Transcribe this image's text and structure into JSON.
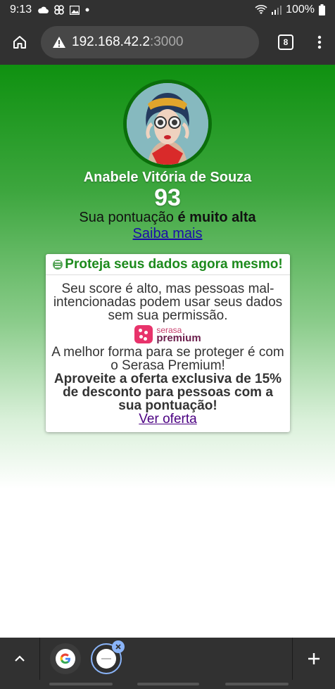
{
  "status_bar": {
    "time": "9:13",
    "battery": "100%",
    "icons": [
      "cloud-icon",
      "pinwheel-icon",
      "image-icon",
      "dot-icon",
      "wifi-icon",
      "signal-icon",
      "battery-icon"
    ]
  },
  "browser": {
    "url_host": "192.168.42.2",
    "url_port": ":3000",
    "tab_count": "8",
    "icons": [
      "home-icon",
      "warning-icon",
      "menu-icon"
    ]
  },
  "profile": {
    "name": "Anabele Vitória de Souza",
    "score": "93",
    "score_prefix": "Sua pontuação ",
    "score_level": "é muito alta",
    "learn_more": "Saiba mais"
  },
  "card": {
    "title": "Proteja seus dados agora mesmo!",
    "paragraph1": "Seu score é alto, mas pessoas mal-intencionadas podem usar seus dados sem sua permissão.",
    "logo_serasa": "serasa",
    "logo_premium": "premium",
    "paragraph2": "A melhor forma para se proteger é com o Serasa Premium!",
    "offer": "Aproveite a oferta exclusiva de 15% de desconto para pessoas com a sua pontuação!",
    "cta": "Ver oferta"
  },
  "colors": {
    "brand_green": "#0f9110",
    "title_green": "#1c8a1c",
    "link_blue": "#1a0dab",
    "link_visited": "#4b0082",
    "serasa_pink": "#e8336b",
    "chrome_dark": "#313131"
  }
}
